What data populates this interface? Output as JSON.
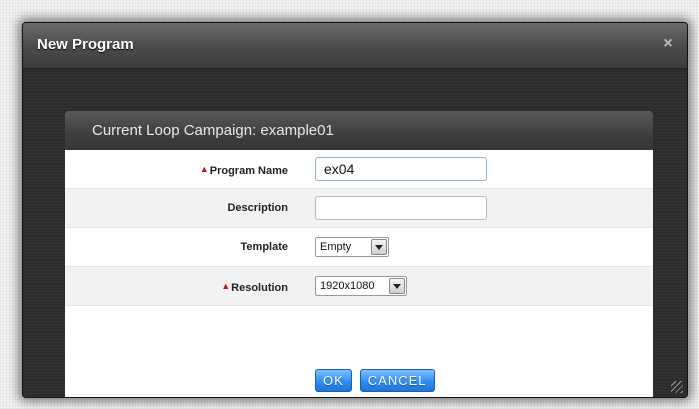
{
  "dialog": {
    "title": "New Program",
    "close_glyph": "×",
    "close_icon": "close-icon"
  },
  "panel": {
    "heading": "Current Loop Campaign: example01"
  },
  "form": {
    "required_glyph": "▲",
    "program_name": {
      "label": "Program Name",
      "value": "ex04",
      "required": true
    },
    "description": {
      "label": "Description",
      "value": "",
      "required": false
    },
    "template": {
      "label": "Template",
      "selected": "Empty",
      "required": false
    },
    "resolution": {
      "label": "Resolution",
      "selected": "1920x1080",
      "required": true
    }
  },
  "buttons": {
    "ok": "OK",
    "cancel": "CANCEL"
  },
  "colors": {
    "required_marker": "#cc1111",
    "button_blue": "#2f8ef0"
  }
}
